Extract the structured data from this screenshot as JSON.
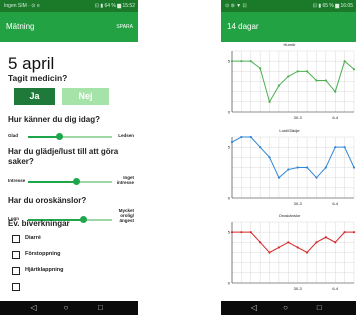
{
  "left": {
    "status_left": "Ingen SIM · ⊙ ≡",
    "status_right": "⊡ ▮ 64 % ▆ 15:52",
    "app_title": "Mätning",
    "save_action": "SPARA",
    "date": "5 april",
    "medicine_question": "Tagit medicin?",
    "yes_label": "Ja",
    "no_label": "Nej",
    "q_feel_line1": "Hur känner du dig idag?",
    "slider_feel": {
      "low": "Glad",
      "high": "Ledsen",
      "value": 0.38
    },
    "q_joy_line1": "Har du glädje/lust till att göra",
    "q_joy_line2": "saker?",
    "slider_joy": {
      "low": "Intresse",
      "high1": "Inget",
      "high2": "intresse",
      "value": 0.58
    },
    "q_anx_line1": "Har du oroskänslor?",
    "slider_anx": {
      "low": "Lugn",
      "high1": "Mycket",
      "high2": "orolig/",
      "high3": "ängest",
      "value": 0.66
    },
    "side_effects_title": "Ev. biverkningar",
    "side_effects": [
      "Diarré",
      "Förstoppning",
      "Hjärtklappning"
    ],
    "nav": {
      "back": "◁",
      "home": "○",
      "recent": "□"
    },
    "colors": {
      "statusbar": "#1a7a2a",
      "appbar": "#23a243",
      "yes": "#1f7a3a",
      "no": "#a6e3a8"
    }
  },
  "right": {
    "status_left": "⊙ ⊚ ▼ ⊡",
    "status_right": "⊡ ▮ 65 % ▆ 16:05",
    "app_title": "14 dagar",
    "nav": {
      "back": "◁",
      "home": "○",
      "recent": "□"
    }
  },
  "chart_data": [
    {
      "type": "line",
      "title": "Humör",
      "color": "#4caf50",
      "ylim": [
        0,
        6
      ],
      "yticks": [
        5,
        0
      ],
      "xticks": [
        "30-3",
        "6-4"
      ],
      "x": [
        0,
        1,
        2,
        3,
        4,
        5,
        6,
        7,
        8,
        9,
        10,
        11,
        12,
        13
      ],
      "values": [
        5,
        5,
        5,
        4.3,
        1,
        2.6,
        3.5,
        4,
        4,
        3.1,
        3.1,
        2,
        5,
        4.2
      ]
    },
    {
      "type": "line",
      "title": "Lust/Glädje",
      "color": "#2f86d8",
      "ylim": [
        0,
        6
      ],
      "yticks": [
        5,
        0
      ],
      "xticks": [
        "30-3",
        "6-4"
      ],
      "x": [
        0,
        1,
        2,
        3,
        4,
        5,
        6,
        7,
        8,
        9,
        10,
        11,
        12,
        13
      ],
      "values": [
        5.5,
        6,
        6,
        5,
        4,
        2,
        2.8,
        3,
        3,
        2,
        3,
        5,
        5,
        3
      ]
    },
    {
      "type": "line",
      "title": "Oroskänslor",
      "color": "#d62728",
      "ylim": [
        0,
        6
      ],
      "yticks": [
        5,
        0
      ],
      "xticks": [
        "30-3",
        "6-4"
      ],
      "x": [
        0,
        1,
        2,
        3,
        4,
        5,
        6,
        7,
        8,
        9,
        10,
        11,
        12,
        13
      ],
      "values": [
        5,
        5,
        5,
        4,
        3,
        3.5,
        4,
        3.5,
        3,
        4,
        4.5,
        4,
        5,
        5
      ]
    }
  ]
}
